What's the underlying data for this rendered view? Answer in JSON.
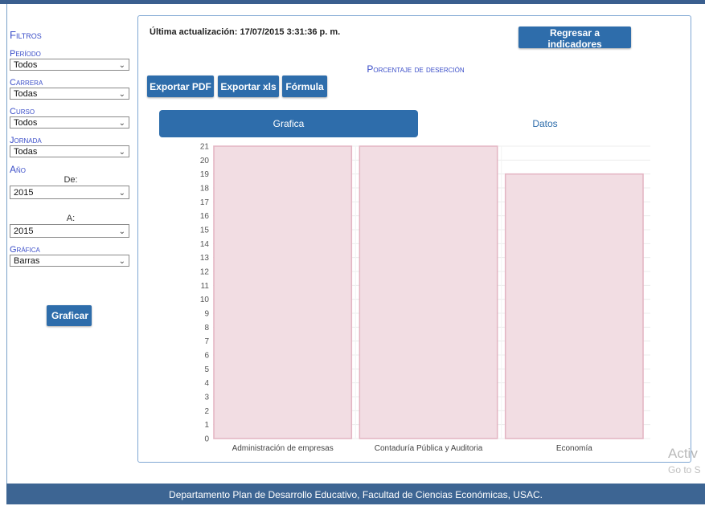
{
  "sidebar": {
    "title": "Filtros",
    "periodo": {
      "label": "Período",
      "value": "Todos"
    },
    "carrera": {
      "label": "Carrera",
      "value": "Todas"
    },
    "curso": {
      "label": "Curso",
      "value": "Todos"
    },
    "jornada": {
      "label": "Jornada",
      "value": "Todas"
    },
    "anio": {
      "label": "Año",
      "from_label": "De:",
      "from_value": "2015",
      "to_label": "A:",
      "to_value": "2015"
    },
    "grafica": {
      "label": "Gráfica",
      "value": "Barras"
    },
    "submit_label": "Graficar"
  },
  "main": {
    "last_update": "Última actualización: 17/07/2015 3:31:36 p. m.",
    "back_label": "Regresar a indicadores",
    "indicator_title": "Porcentaje de deserción",
    "toolbar": {
      "export_pdf": "Exportar PDF",
      "export_xls": "Exportar xls",
      "formula": "Fórmula"
    },
    "tabs": [
      {
        "label": "Grafica",
        "active": true
      },
      {
        "label": "Datos",
        "active": false
      }
    ]
  },
  "chart_data": {
    "type": "bar",
    "categories": [
      "Administración de empresas",
      "Contaduría Pública y Auditoria",
      "Economía"
    ],
    "values": [
      21,
      21,
      19
    ],
    "ylim": [
      0,
      21
    ],
    "yticks": [
      0,
      1,
      2,
      3,
      4,
      5,
      6,
      7,
      8,
      9,
      10,
      11,
      12,
      13,
      14,
      15,
      16,
      17,
      18,
      19,
      20,
      21
    ],
    "grid": true,
    "bar_fill": "#f2dde3",
    "bar_stroke": "#e3b4c2"
  },
  "footer": {
    "text": "Departamento Plan de Desarrollo Educativo, Facultad de Ciencias Económicas, USAC."
  },
  "watermark": {
    "line1": "Activ",
    "line2": "Go to S"
  },
  "colors": {
    "accent": "#2e6dab",
    "label": "#3b4ec8",
    "footer": "#3d6593"
  }
}
